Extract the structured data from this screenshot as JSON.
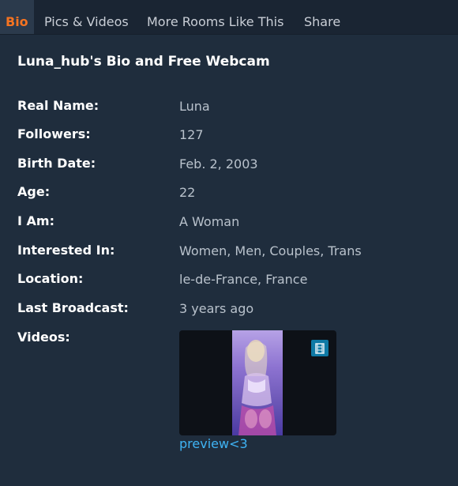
{
  "tabs": [
    {
      "label": "Bio",
      "active": true
    },
    {
      "label": "Pics & Videos",
      "active": false
    },
    {
      "label": "More Rooms Like This",
      "active": false
    },
    {
      "label": "Share",
      "active": false
    }
  ],
  "bio": {
    "title": "Luna_hub's Bio and Free Webcam",
    "rows": [
      {
        "label": "Real Name:",
        "value": "Luna"
      },
      {
        "label": "Followers:",
        "value": "127"
      },
      {
        "label": "Birth Date:",
        "value": "Feb. 2, 2003"
      },
      {
        "label": "Age:",
        "value": "22"
      },
      {
        "label": "I Am:",
        "value": "A Woman"
      },
      {
        "label": "Interested In:",
        "value": "Women, Men, Couples, Trans"
      },
      {
        "label": "Location:",
        "value": "le-de-France, France"
      },
      {
        "label": "Last Broadcast:",
        "value": "3 years ago"
      }
    ],
    "videos_label": "Videos:",
    "video": {
      "caption": "preview<3",
      "icon": "film-strip-icon"
    }
  },
  "colors": {
    "background": "#1f2d3d",
    "tabbar": "#1a2533",
    "active_tab_bg": "#2b3a4c",
    "active_tab_text": "#f47321",
    "link": "#3fb4f5",
    "video_icon_bg": "#0e79a5"
  }
}
